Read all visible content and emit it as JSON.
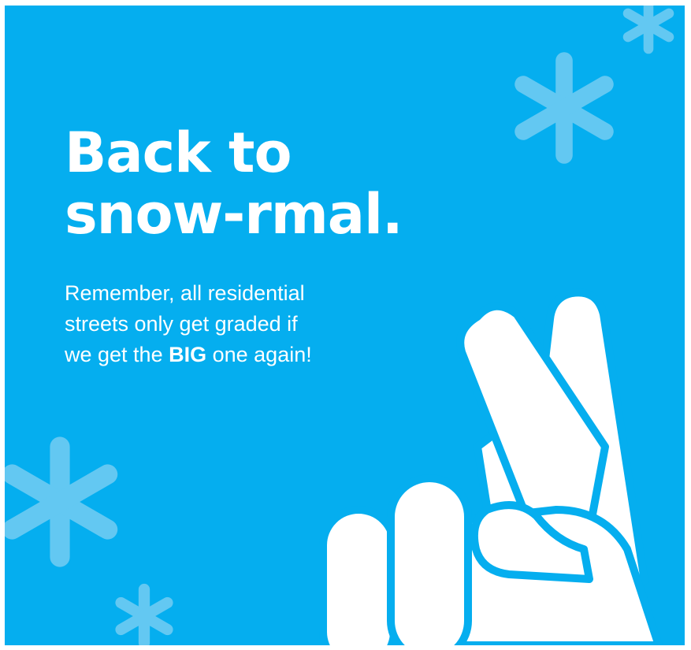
{
  "colors": {
    "background": "#05AEEF",
    "snowflake": "#63C8F2",
    "hand": "#FFFFFF",
    "hand_outline": "#05AEEF",
    "text": "#FFFFFF"
  },
  "headline": {
    "line1": "Back to",
    "line2": "snow-rmal."
  },
  "message": {
    "line1": "Remember,  all residential",
    "line2": "streets only get graded if",
    "line3_before": "we get the ",
    "line3_bold": "BIG",
    "line3_after": " one again!"
  },
  "icons": {
    "snowflakes": [
      "snowflake-icon",
      "snowflake-icon",
      "snowflake-icon",
      "snowflake-icon"
    ],
    "hand": "crossed-fingers-icon"
  }
}
